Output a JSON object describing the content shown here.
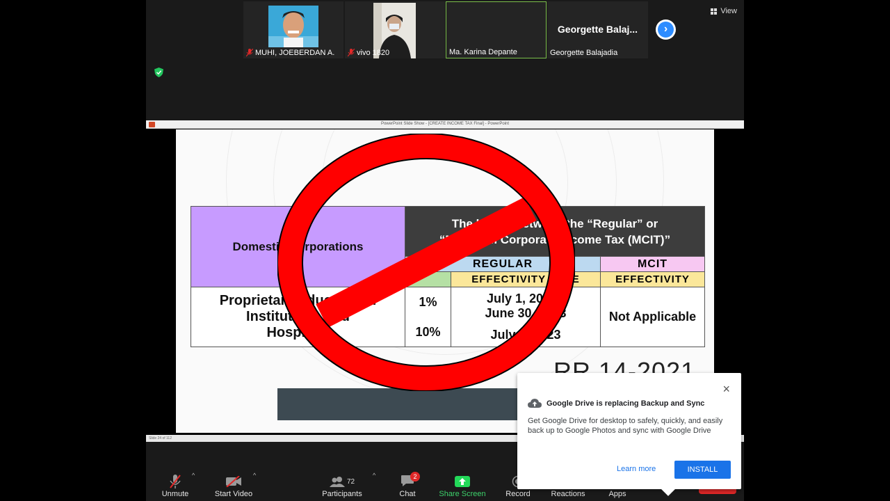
{
  "participants": [
    {
      "name": "MUHI, JOEBERDAN A.",
      "muted": true
    },
    {
      "name": "vivo 1820",
      "muted": true
    },
    {
      "name": "Ma. Karina Depante",
      "muted": false
    },
    {
      "name": "Georgette Balajadia",
      "display_name": "Georgette  Balaj...",
      "muted": false
    }
  ],
  "view_label": "View",
  "powerpoint": {
    "titlebar": "PowerPoint Slide Show - [CREATE INCOME TAX Final] - PowerPoint",
    "status": "Slide 24 of 112"
  },
  "slide": {
    "domestic_label": "Domestic Corporations",
    "header_line1": "The higher between the “Regular” or",
    "header_line2": "“Minimum Corporate Income Tax (MCIT)”",
    "regular_label": "REGULAR",
    "mcit_label": "MCIT",
    "effectivity_label": "EFFECTIVITY",
    "date_label": "DATE",
    "effectivity2_label": "EFFECTIVITY",
    "entity_line1": "Proprietary Educational",
    "entity_line2": "Institutions and",
    "entity_line3": "Hospitals",
    "rate1": "1%",
    "rate2": "10%",
    "date1_line1": "July 1, 2020 -",
    "date1_line2": "June 30, 2023",
    "date2": "July 1, 2023",
    "not_applicable": "Not Applicable",
    "rr": "RR 14-2021"
  },
  "toolbar": {
    "unmute": "Unmute",
    "start_video": "Start Video",
    "participants": "Participants",
    "participants_count": "72",
    "chat": "Chat",
    "chat_badge": "2",
    "share_screen": "Share Screen",
    "record": "Record",
    "reactions": "Reactions",
    "apps": "Apps"
  },
  "popup": {
    "title": "Google Drive is replacing Backup and Sync",
    "body": "Get Google Drive for desktop to safely, quickly, and easily back up to Google Photos and sync with Google Drive",
    "learn_more": "Learn more",
    "install": "INSTALL"
  },
  "colors": {
    "accent": "#2d8cff",
    "share_green": "#23d959",
    "share_label": "#3dd26b",
    "muted_red": "#e02828",
    "google_blue": "#1a73e8"
  }
}
